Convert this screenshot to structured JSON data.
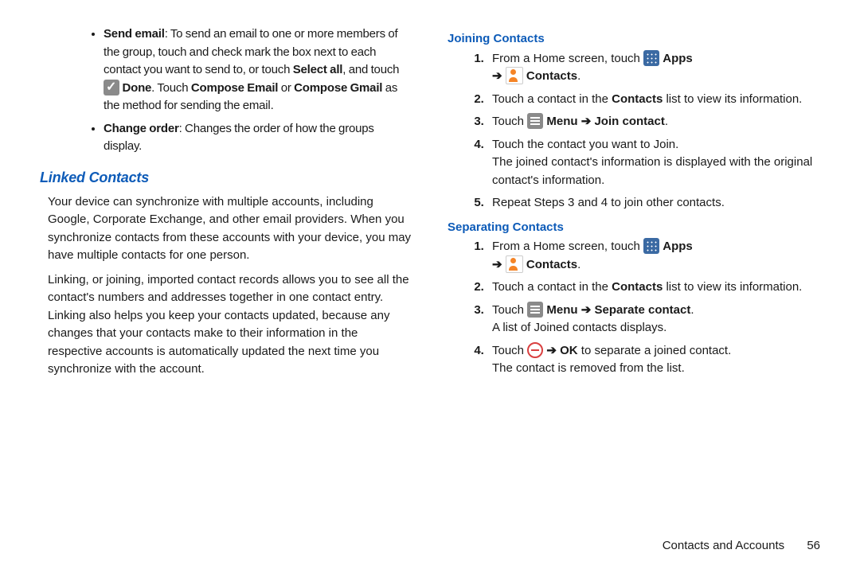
{
  "left": {
    "bullets": [
      {
        "lead": "Send email",
        "rest1": ": To send an email to one or more members of the group, touch and check mark the box next to each contact you want to send to, or touch ",
        "selectAll": "Select all",
        "rest2": ", and touch ",
        "done": "Done",
        "rest3": ". Touch ",
        "composeEmail": "Compose Email",
        "or": " or ",
        "composeGmail": "Compose Gmail",
        "rest4": " as the method for sending the email."
      },
      {
        "lead": "Change order",
        "rest": ": Changes the order of how the groups display."
      }
    ],
    "hdr": "Linked Contacts",
    "p1": "Your device can synchronize with multiple accounts, including Google, Corporate Exchange, and other email providers. When you synchronize contacts from these accounts with your device, you may have multiple contacts for one person.",
    "p2": "Linking, or joining, imported contact records allows you to see all the contact's numbers and addresses together in one contact entry. Linking also helps you keep your contacts updated, because any changes that your contacts make to their information in the respective accounts is automatically updated the next time you synchronize with the account."
  },
  "right": {
    "hdrJoin": "Joining Contacts",
    "hdrSep": "Separating Contacts",
    "fromHome": "From a Home screen, touch ",
    "apps": "Apps",
    "arrow": "➔",
    "contacts": "Contacts",
    "period": ".",
    "step2a": "Touch a contact in the ",
    "step2b": " list to view its information.",
    "touch": "Touch ",
    "menu": "Menu",
    "joinContact": "Join contact",
    "sepContact": "Separate contact",
    "step4j": "Touch the contact you want to Join.",
    "step4j2": "The joined contact's information is displayed with the original contact's information.",
    "step5j": "Repeat Steps 3 and 4 to join other contacts.",
    "sep3b": "A list of Joined contacts displays.",
    "sep4a": "Touch ",
    "ok": "OK",
    "sep4b": " to separate a joined contact.",
    "sep4c": "The contact is removed from the list."
  },
  "footer": {
    "section": "Contacts and Accounts",
    "page": "56"
  }
}
